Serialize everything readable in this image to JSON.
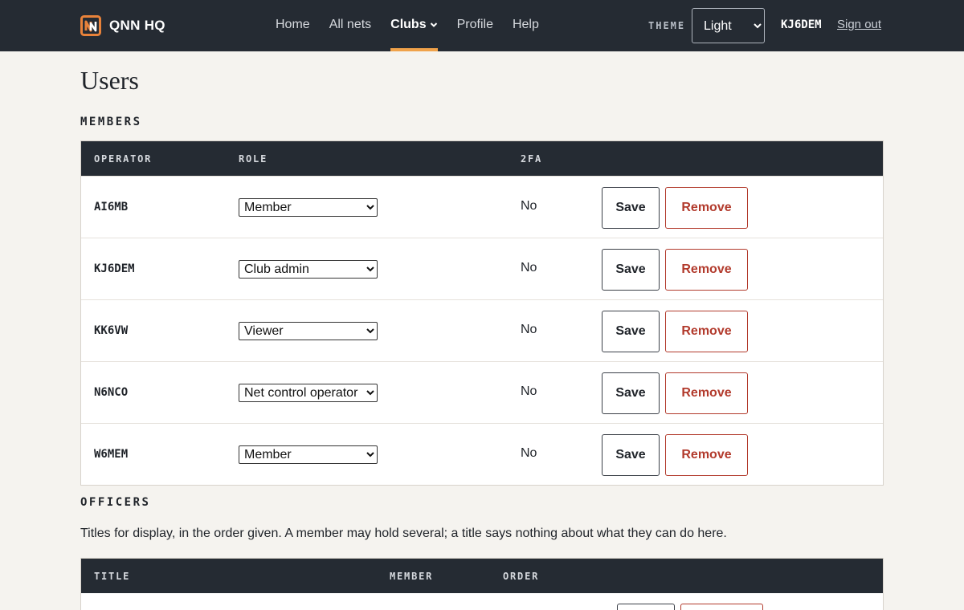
{
  "header": {
    "brand": "QNN HQ",
    "nav": [
      {
        "label": "Home"
      },
      {
        "label": "All nets"
      },
      {
        "label": "Clubs",
        "active": true
      },
      {
        "label": "Profile"
      },
      {
        "label": "Help"
      }
    ],
    "theme_label": "THEME",
    "theme_value": "Light",
    "theme_options": [
      "Light"
    ],
    "user_callsign": "KJ6DEM",
    "signout_label": "Sign out",
    "accent_color": "#f0a24a"
  },
  "page": {
    "title": "Users"
  },
  "members": {
    "heading": "MEMBERS",
    "columns": [
      "OPERATOR",
      "ROLE",
      "2FA"
    ],
    "rows": [
      {
        "callsign": "AI6MB",
        "role": "Member",
        "twofa": "No"
      },
      {
        "callsign": "KJ6DEM",
        "role": "Club admin",
        "twofa": "No"
      },
      {
        "callsign": "KK6VW",
        "role": "Viewer",
        "twofa": "No"
      },
      {
        "callsign": "N6NCO",
        "role": "Net control operator",
        "twofa": "No"
      },
      {
        "callsign": "W6MEM",
        "role": "Member",
        "twofa": "No"
      }
    ],
    "save_label": "Save",
    "remove_label": "Remove",
    "remove_color": "#b23a2c"
  },
  "officers": {
    "heading": "OFFICERS",
    "description": "Titles for display, in the order given. A member may hold several; a title says nothing about what they can do here.",
    "columns": [
      "TITLE",
      "MEMBER",
      "ORDER"
    ]
  }
}
